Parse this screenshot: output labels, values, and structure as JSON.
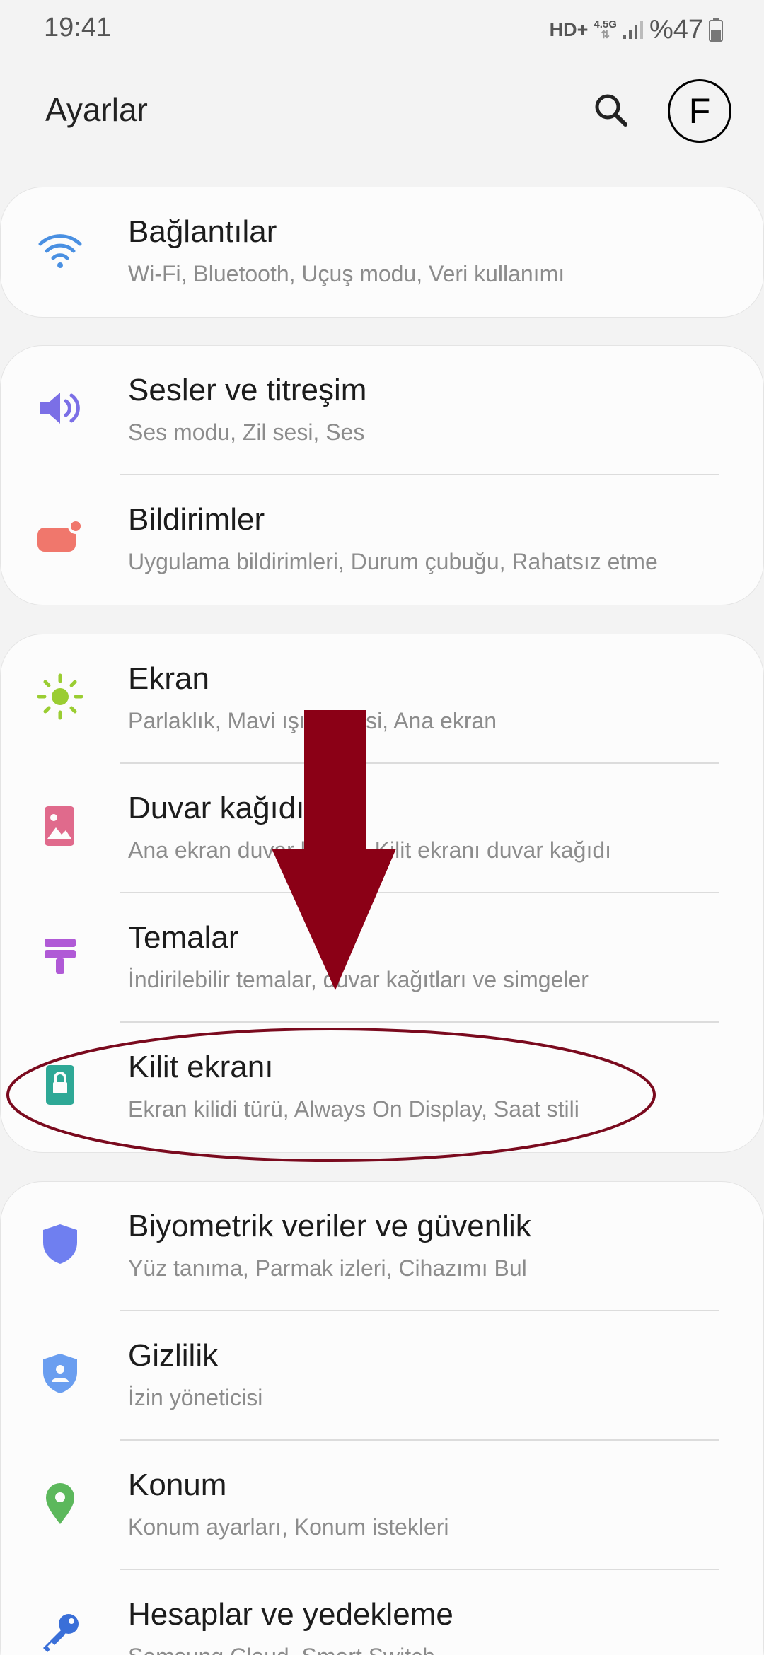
{
  "status_bar": {
    "time": "19:41",
    "network": "HD+",
    "generation": "4.5G",
    "battery": "%47"
  },
  "header": {
    "title": "Ayarlar",
    "avatar_letter": "F",
    "search_icon": "search-icon"
  },
  "cards": [
    {
      "items": [
        {
          "title": "Bağlantılar",
          "subtitle": "Wi-Fi, Bluetooth, Uçuş modu, Veri kullanımı",
          "icon": "wifi-icon",
          "color": "#4a90e2"
        }
      ]
    },
    {
      "items": [
        {
          "title": "Sesler ve titreşim",
          "subtitle": "Ses modu, Zil sesi, Ses",
          "icon": "volume-icon",
          "color": "#7b6fe6"
        },
        {
          "title": "Bildirimler",
          "subtitle": "Uygulama bildirimleri, Durum çubuğu, Rahatsız etme",
          "icon": "notification-icon",
          "color": "#f0776c"
        }
      ]
    },
    {
      "items": [
        {
          "title": "Ekran",
          "subtitle": "Parlaklık, Mavi ışık filtresi, Ana ekran",
          "icon": "brightness-icon",
          "color": "#9acd32"
        },
        {
          "title": "Duvar kağıdı",
          "subtitle": "Ana ekran duvar kağıdı, Kilit ekranı duvar kağıdı",
          "icon": "wallpaper-icon",
          "color": "#e06a8c"
        },
        {
          "title": "Temalar",
          "subtitle": "İndirilebilir temalar, duvar kağıtları ve simgeler",
          "icon": "themes-icon",
          "color": "#b05ad6"
        },
        {
          "title": "Kilit ekranı",
          "subtitle": "Ekran kilidi türü, Always On Display, Saat stili",
          "icon": "lock-icon",
          "color": "#2ea896"
        }
      ]
    },
    {
      "items": [
        {
          "title": "Biyometrik veriler ve güvenlik",
          "subtitle": "Yüz tanıma, Parmak izleri, Cihazımı Bul",
          "icon": "shield-icon",
          "color": "#6f7ff0"
        },
        {
          "title": "Gizlilik",
          "subtitle": "İzin yöneticisi",
          "icon": "privacy-icon",
          "color": "#6a9ef0"
        },
        {
          "title": "Konum",
          "subtitle": "Konum ayarları, Konum istekleri",
          "icon": "location-icon",
          "color": "#5cb85c"
        },
        {
          "title": "Hesaplar ve yedekleme",
          "subtitle": "Samsung Cloud, Smart Switch",
          "icon": "key-icon",
          "color": "#3a6fd8"
        }
      ]
    }
  ],
  "annotation": {
    "arrow_color": "#8b0016",
    "highlight_color": "#7a0a1e"
  }
}
